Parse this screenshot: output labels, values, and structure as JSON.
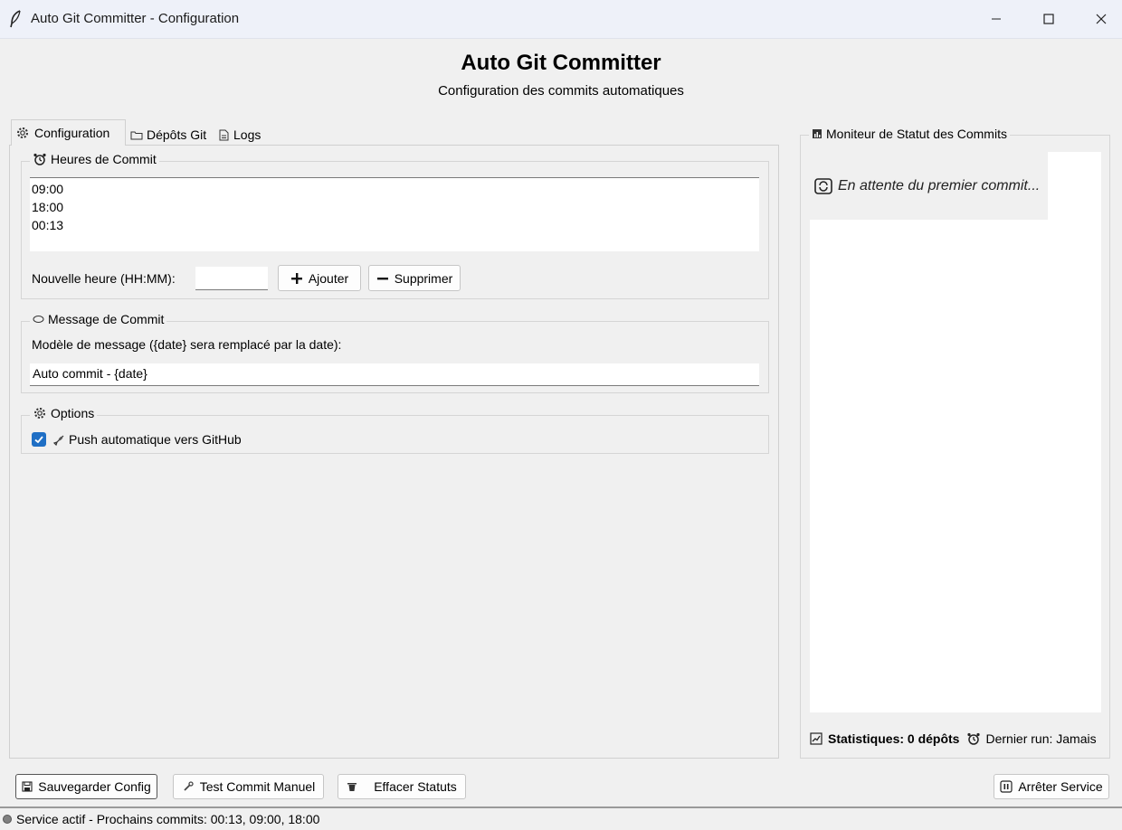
{
  "window": {
    "title": "Auto Git Committer - Configuration",
    "app_icon": "feather-icon",
    "controls": [
      "minimize-icon",
      "maximize-icon",
      "close-icon"
    ]
  },
  "header": {
    "title": "Auto Git Committer",
    "subtitle": "Configuration des commits automatiques"
  },
  "tabs": [
    {
      "label": "Configuration",
      "icon": "gear-icon",
      "selected": true
    },
    {
      "label": "Dépôts Git",
      "icon": "folder-icon",
      "selected": false
    },
    {
      "label": "Logs",
      "icon": "document-icon",
      "selected": false
    }
  ],
  "commit_hours": {
    "title": "Heures de Commit",
    "icon": "alarm-clock-icon",
    "times": [
      "09:00",
      "18:00",
      "00:13"
    ],
    "new_label": "Nouvelle heure (HH:MM):",
    "new_value": "",
    "add_label": "Ajouter",
    "remove_label": "Supprimer"
  },
  "commit_message": {
    "title": "Message de Commit",
    "icon": "speech-bubble-icon",
    "template_label": "Modèle de message ({date} sera remplacé par la date):",
    "template_value": "Auto commit - {date}"
  },
  "options": {
    "title": "Options",
    "icon": "gear-icon",
    "push_label": "Push automatique vers GitHub",
    "push_checked": true,
    "push_icon": "rocket-icon"
  },
  "monitor": {
    "title": "Moniteur de Statut des Commits",
    "icon": "chart-icon",
    "waiting_message": "En attente du premier commit...",
    "waiting_icon": "refresh-icon",
    "stats_label": "Statistiques: 0 dépôts",
    "last_run_label": "Dernier run: Jamais"
  },
  "actions": {
    "save": "Sauvegarder Config",
    "test": "Test Commit Manuel",
    "clear": "Effacer Statuts",
    "stop": "Arrêter Service"
  },
  "status_bar": {
    "text": "Service actif - Prochains commits: 00:13, 09:00, 18:00",
    "indicator_color": "#808080"
  },
  "colors": {
    "accent": "#1f6fc5",
    "window_bg": "#f0f0f0",
    "titlebar_bg": "#eef1f9"
  }
}
